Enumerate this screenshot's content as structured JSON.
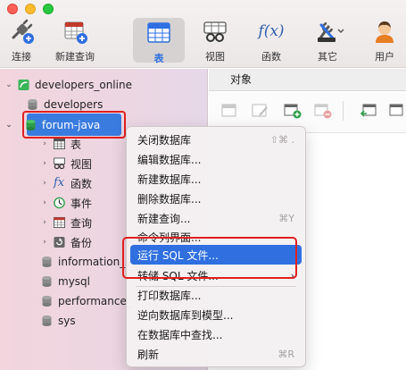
{
  "toolbar": {
    "items": [
      {
        "label": "连接",
        "icon": "plug-icon"
      },
      {
        "label": "新建查询",
        "icon": "new-query-icon"
      },
      {
        "label": "表",
        "icon": "table-icon",
        "active": true
      },
      {
        "label": "视图",
        "icon": "view-icon"
      },
      {
        "label": "函数",
        "icon": "function-icon"
      },
      {
        "label": "其它",
        "icon": "tools-icon"
      },
      {
        "label": "用户",
        "icon": "user-icon"
      }
    ],
    "function_glyph": "f(x)"
  },
  "sidebar": {
    "connection": "developers_online",
    "databases": [
      {
        "name": "developers"
      },
      {
        "name": "forum-java",
        "selected": true
      },
      {
        "name": "information_s"
      },
      {
        "name": "mysql"
      },
      {
        "name": "performance_"
      },
      {
        "name": "sys"
      }
    ],
    "children": [
      {
        "label": "表",
        "icon": "table-icon"
      },
      {
        "label": "视图",
        "icon": "view-icon"
      },
      {
        "label": "函数",
        "icon": "function-icon"
      },
      {
        "label": "事件",
        "icon": "clock-icon"
      },
      {
        "label": "查询",
        "icon": "query-icon"
      },
      {
        "label": "备份",
        "icon": "backup-icon"
      }
    ]
  },
  "right_pane": {
    "tab": "对象"
  },
  "context_menu": {
    "items": [
      {
        "label": "关闭数据库",
        "shortcut": "⇧⌘ ."
      },
      {
        "label": "编辑数据库...",
        "shortcut": ""
      },
      {
        "label": "新建数据库...",
        "shortcut": ""
      },
      {
        "label": "删除数据库...",
        "shortcut": ""
      },
      {
        "label": "新建查询...",
        "shortcut": "⌘Y"
      },
      {
        "label": "命令列界面...",
        "shortcut": ""
      },
      {
        "label": "运行 SQL 文件...",
        "shortcut": "",
        "highlighted": true
      },
      {
        "label": "转储 SQL 文件...",
        "shortcut": "",
        "submenu": true
      },
      {
        "label": "打印数据库...",
        "shortcut": ""
      },
      {
        "label": "逆向数据库到模型...",
        "shortcut": ""
      },
      {
        "label": "在数据库中查找...",
        "shortcut": ""
      },
      {
        "label": "刷新",
        "shortcut": "⌘R"
      }
    ],
    "submenu_arrow": "›"
  },
  "colors": {
    "accent": "#2f6fe0",
    "annotation_red": "#e02020",
    "sidebar_bg": "#f2d5dd",
    "db_icon": "#2e9d48"
  }
}
